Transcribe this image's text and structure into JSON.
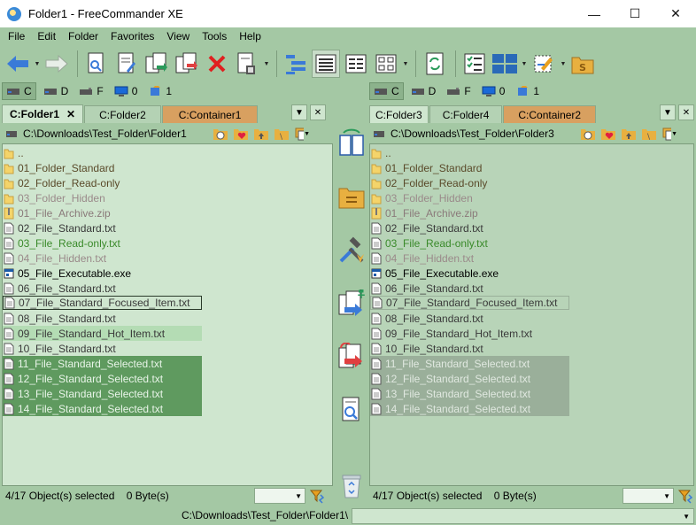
{
  "window": {
    "title": "Folder1 - FreeCommander XE",
    "minimize": "—",
    "maximize": "☐",
    "close": "✕"
  },
  "menu": [
    "File",
    "Edit",
    "Folder",
    "Favorites",
    "View",
    "Tools",
    "Help"
  ],
  "toolbar": {
    "icons": [
      "back-arrow-icon",
      "forward-arrow-icon",
      "view-file-icon",
      "edit-file-icon",
      "copy-file-icon",
      "move-file-icon",
      "delete-icon",
      "pack-icon",
      "tree-view-icon",
      "details-view-icon",
      "list-view-icon",
      "thumbnails-view-icon",
      "sync-icon",
      "multi-rename-icon",
      "layout-icon",
      "settings-icon",
      "bookmark-s-icon"
    ]
  },
  "colors": {
    "accent_green": "#a4c8a4",
    "panel_left": "#cfe6cf",
    "panel_right": "#b8d4b8",
    "selected_left": "#5f9a5f",
    "selected_right": "#9aaf9a",
    "hot_item": "#b4dcb4",
    "container_tab": "#d8a060",
    "back_arrow": "#3a7ad8",
    "delete_red": "#e02020"
  },
  "left": {
    "drives": [
      {
        "letter": "C",
        "icon": "hard-drive-icon"
      },
      {
        "letter": "D",
        "icon": "hard-drive-icon"
      },
      {
        "letter": "F",
        "icon": "usb-drive-icon"
      },
      {
        "letter": "0",
        "icon": "desktop-icon"
      },
      {
        "letter": "1",
        "icon": "network-icon"
      }
    ],
    "tabs": [
      {
        "label": "C:Folder1",
        "close": "✕"
      },
      {
        "label": "C:Folder2"
      },
      {
        "label": "C:Container1"
      }
    ],
    "tab_dropdown": "▼",
    "tab_close": "✕",
    "path": "C:\\Downloads\\Test_Folder\\Folder1",
    "status": "4/17 Object(s) selected    0 Byte(s)"
  },
  "right": {
    "drives": [
      {
        "letter": "C",
        "icon": "hard-drive-icon"
      },
      {
        "letter": "D",
        "icon": "hard-drive-icon"
      },
      {
        "letter": "F",
        "icon": "usb-drive-icon"
      },
      {
        "letter": "0",
        "icon": "desktop-icon"
      },
      {
        "letter": "1",
        "icon": "network-icon"
      }
    ],
    "tabs": [
      {
        "label": "C:Folder3"
      },
      {
        "label": "C:Folder4"
      },
      {
        "label": "C:Container2"
      }
    ],
    "tab_dropdown": "▼",
    "tab_close": "✕",
    "path": "C:\\Downloads\\Test_Folder\\Folder3",
    "status": "4/17 Object(s) selected    0 Byte(s)"
  },
  "files": [
    {
      "name": "..",
      "type": "folder",
      "style": "std"
    },
    {
      "name": "01_Folder_Standard",
      "type": "folder",
      "style": "std"
    },
    {
      "name": "02_Folder_Read-only",
      "type": "folder",
      "style": "std"
    },
    {
      "name": "03_Folder_Hidden",
      "type": "folder",
      "style": "hidden"
    },
    {
      "name": "01_File_Archive.zip",
      "type": "zip",
      "style": "arc"
    },
    {
      "name": "02_File_Standard.txt",
      "type": "file",
      "style": "std"
    },
    {
      "name": "03_File_Read-only.txt",
      "type": "file",
      "style": "ro"
    },
    {
      "name": "04_File_Hidden.txt",
      "type": "file",
      "style": "hidden"
    },
    {
      "name": "05_File_Executable.exe",
      "type": "exe",
      "style": "exe"
    },
    {
      "name": "06_File_Standard.txt",
      "type": "file",
      "style": "std"
    },
    {
      "name": "07_File_Standard_Focused_Item.txt",
      "type": "file",
      "style": "std",
      "state": "focused"
    },
    {
      "name": "08_File_Standard.txt",
      "type": "file",
      "style": "std"
    },
    {
      "name": "09_File_Standard_Hot_Item.txt",
      "type": "file",
      "style": "std",
      "state": "hot"
    },
    {
      "name": "10_File_Standard.txt",
      "type": "file",
      "style": "std"
    },
    {
      "name": "11_File_Standard_Selected.txt",
      "type": "file",
      "style": "std",
      "state": "selected"
    },
    {
      "name": "12_File_Standard_Selected.txt",
      "type": "file",
      "style": "std",
      "state": "selected"
    },
    {
      "name": "13_File_Standard_Selected.txt",
      "type": "file",
      "style": "std",
      "state": "selected"
    },
    {
      "name": "14_File_Standard_Selected.txt",
      "type": "file",
      "style": "std",
      "state": "selected"
    }
  ],
  "cmdline": {
    "path": "C:\\Downloads\\Test_Folder\\Folder1\\",
    "value": ""
  }
}
